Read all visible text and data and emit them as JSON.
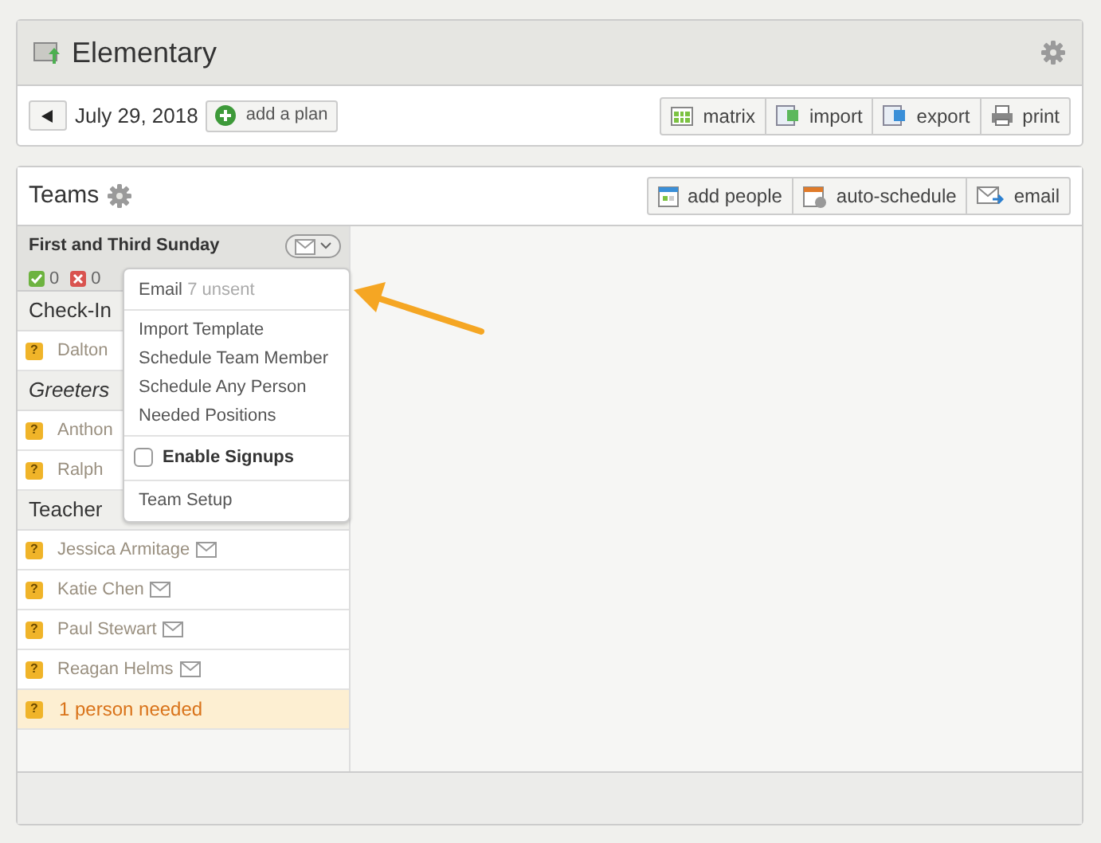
{
  "plan": {
    "title": "Elementary",
    "date": "July 29, 2018",
    "add_plan": "add a plan",
    "actions": [
      {
        "kind": "matrix",
        "label": "matrix"
      },
      {
        "kind": "import",
        "label": "import"
      },
      {
        "kind": "export",
        "label": "export"
      },
      {
        "kind": "print",
        "label": "print"
      }
    ]
  },
  "teams": {
    "title": "Teams",
    "actions": [
      {
        "kind": "add",
        "label": "add people"
      },
      {
        "kind": "auto",
        "label": "auto-schedule"
      },
      {
        "kind": "email",
        "label": "email"
      }
    ],
    "column": {
      "title": "First and Third Sunday",
      "confirmed": "0",
      "declined": "0"
    },
    "rows": [
      {
        "kind": "group",
        "label": "Check-In",
        "emphasized": false
      },
      {
        "kind": "person",
        "badge": "?",
        "label": "Dalton",
        "mail": false
      },
      {
        "kind": "group",
        "label": "Greeters",
        "emphasized": true
      },
      {
        "kind": "person",
        "badge": "?",
        "label": "Anthon",
        "mail": false
      },
      {
        "kind": "person",
        "badge": "?",
        "label": "Ralph",
        "mail": false
      },
      {
        "kind": "group",
        "label": "Teacher",
        "emphasized": false
      },
      {
        "kind": "person",
        "badge": "?",
        "label": "Jessica Armitage",
        "mail": true
      },
      {
        "kind": "person",
        "badge": "?",
        "label": "Katie Chen",
        "mail": true
      },
      {
        "kind": "person",
        "badge": "?",
        "label": "Paul Stewart",
        "mail": true
      },
      {
        "kind": "person",
        "badge": "?",
        "label": "Reagan Helms",
        "mail": true
      },
      {
        "kind": "needed",
        "badge": "?",
        "label": "1 person needed"
      }
    ]
  },
  "menu": {
    "items": [
      {
        "kind": "email",
        "label": "Email",
        "note": "7 unsent"
      },
      {
        "kind": "divider"
      },
      {
        "kind": "item",
        "label": "Import Template"
      },
      {
        "kind": "item",
        "label": "Schedule Team Member"
      },
      {
        "kind": "item",
        "label": "Schedule Any Person"
      },
      {
        "kind": "item",
        "label": "Needed Positions"
      },
      {
        "kind": "divider"
      },
      {
        "kind": "check",
        "label": "Enable Signups",
        "checked": false
      },
      {
        "kind": "divider"
      },
      {
        "kind": "item",
        "label": "Team Setup"
      }
    ]
  }
}
